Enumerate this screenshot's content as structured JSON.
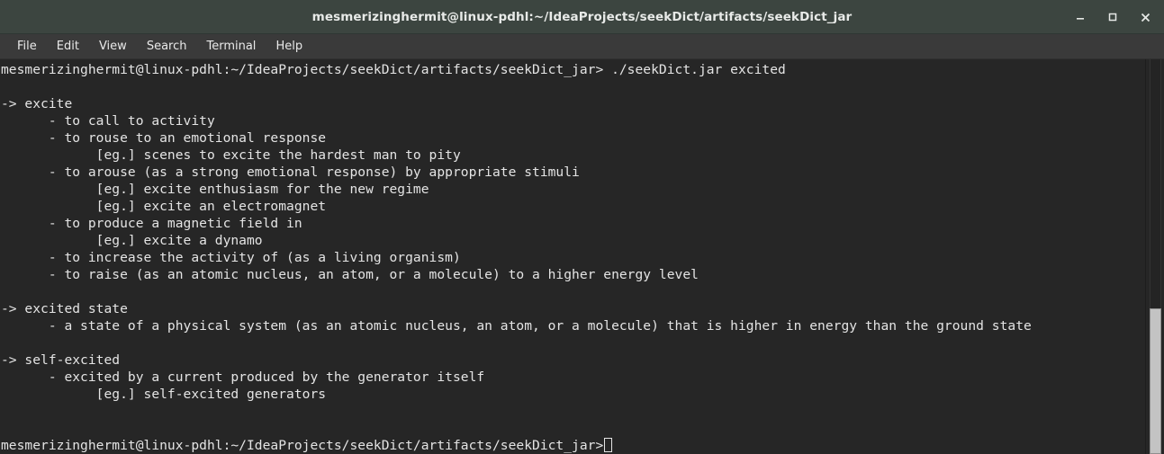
{
  "window": {
    "title": "mesmerizinghermit@linux-pdhl:~/IdeaProjects/seekDict/artifacts/seekDict_jar",
    "controls": {
      "minimize": "minimize-icon",
      "maximize": "maximize-icon",
      "close": "close-icon"
    },
    "colors": {
      "titlebar_bg": "#3c4540",
      "menubar_bg": "#3a3a3a",
      "terminal_bg": "#262626",
      "text": "#e4e4e4",
      "scrollbar_thumb": "#c3c3c3"
    }
  },
  "menubar": {
    "items": [
      {
        "label": "File"
      },
      {
        "label": "Edit"
      },
      {
        "label": "View"
      },
      {
        "label": "Search"
      },
      {
        "label": "Terminal"
      },
      {
        "label": "Help"
      }
    ]
  },
  "terminal": {
    "prompt": "mesmerizinghermit@linux-pdhl:~/IdeaProjects/seekDict/artifacts/seekDict_jar>",
    "command": "./seekDict.jar excited",
    "command_line": "mesmerizinghermit@linux-pdhl:~/IdeaProjects/seekDict/artifacts/seekDict_jar> ./seekDict.jar excited",
    "lines": [
      "mesmerizinghermit@linux-pdhl:~/IdeaProjects/seekDict/artifacts/seekDict_jar> ./seekDict.jar excited",
      "",
      "-> excite",
      "      - to call to activity",
      "      - to rouse to an emotional response",
      "            [eg.] scenes to excite the hardest man to pity",
      "      - to arouse (as a strong emotional response) by appropriate stimuli",
      "            [eg.] excite enthusiasm for the new regime",
      "            [eg.] excite an electromagnet",
      "      - to produce a magnetic field in",
      "            [eg.] excite a dynamo",
      "      - to increase the activity of (as a living organism)",
      "      - to raise (as an atomic nucleus, an atom, or a molecule) to a higher energy level",
      "",
      "-> excited state",
      "      - a state of a physical system (as an atomic nucleus, an atom, or a molecule) that is higher in energy than the ground state",
      "",
      "-> self-excited",
      "      - excited by a current produced by the generator itself",
      "            [eg.] self-excited generators",
      "",
      ""
    ],
    "final_prompt": "mesmerizinghermit@linux-pdhl:~/IdeaProjects/seekDict/artifacts/seekDict_jar>",
    "cursor": "block-cursor-outline"
  },
  "scrollbar": {
    "name": "vertical-scrollbar",
    "thumb_top_pct": 63,
    "thumb_height_pct": 37
  }
}
